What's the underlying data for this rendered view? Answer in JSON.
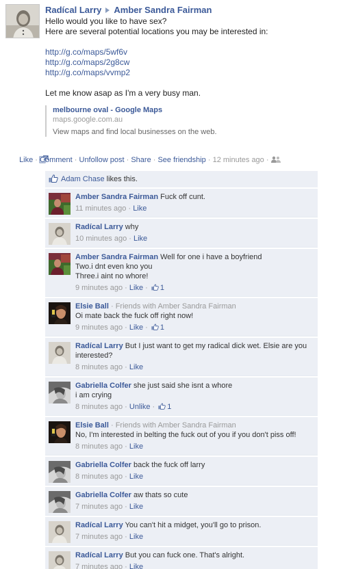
{
  "post": {
    "author": "Radícal Larry",
    "recipient": "Amber Sandra Fairman",
    "lines": [
      "Hello would you like to have sex?",
      "Here are several potential locations you may be interested in:"
    ],
    "links": [
      "http://g.co/maps/5wf6v",
      "http://g.co/maps/2g8cw",
      "http://g.co/maps/vvmp2"
    ],
    "closing": "Let me know asap as I'm a very busy man.",
    "attachment": {
      "title": "melbourne oval - Google Maps",
      "domain": "maps.google.com.au",
      "description": "View maps and find local businesses on the web."
    },
    "actions": {
      "like": "Like",
      "comment": "Comment",
      "unfollow": "Unfollow post",
      "share": "Share",
      "see_friendship": "See friendship",
      "time": "12 minutes ago",
      "dot": " · "
    }
  },
  "likes": {
    "who": "Adam Chase",
    "suffix": " likes this."
  },
  "comments": [
    {
      "author": "Amber Sandra Fairman",
      "text": "Fuck off cunt.",
      "time": "11 minutes ago",
      "action": "Like",
      "likes": "",
      "avatar": "amber"
    },
    {
      "author": "Radícal Larry",
      "text": "why",
      "time": "10 minutes ago",
      "action": "Like",
      "likes": "",
      "avatar": "larry"
    },
    {
      "author": "Amber Sandra Fairman",
      "text": "Well for one i have a boyfriend\nTwo.i dnt even kno you\nThree.i aint no whore!",
      "time": "9 minutes ago",
      "action": "Like",
      "likes": "1",
      "avatar": "amber"
    },
    {
      "author": "Elsie Ball",
      "meta": "Friends with Amber Sandra Fairman",
      "text": "Oi mate back the fuck off right now!",
      "time": "9 minutes ago",
      "action": "Like",
      "likes": "1",
      "avatar": "elsie"
    },
    {
      "author": "Radícal Larry",
      "text": "But I just want to get my radical dick wet. Elsie are you interested?",
      "time": "8 minutes ago",
      "action": "Like",
      "likes": "",
      "avatar": "larry"
    },
    {
      "author": "Gabriella Colfer",
      "text": "she just said she isnt a whore\ni am crying",
      "time": "8 minutes ago",
      "action": "Unlike",
      "likes": "1",
      "avatar": "gabriella"
    },
    {
      "author": "Elsie Ball",
      "meta": "Friends with Amber Sandra Fairman",
      "text": "No, I'm interested in belting the fuck out of you if you don't piss off!",
      "time": "8 minutes ago",
      "action": "Like",
      "likes": "",
      "avatar": "elsie"
    },
    {
      "author": "Gabriella Colfer",
      "text": "back the fuck off larry",
      "time": "8 minutes ago",
      "action": "Like",
      "likes": "",
      "avatar": "gabriella"
    },
    {
      "author": "Gabriella Colfer",
      "text": "aw thats so cute",
      "time": "7 minutes ago",
      "action": "Like",
      "likes": "",
      "avatar": "gabriella"
    },
    {
      "author": "Radícal Larry",
      "text": "You can't hit a midget, you'll go to prison.",
      "time": "7 minutes ago",
      "action": "Like",
      "likes": "",
      "avatar": "larry"
    },
    {
      "author": "Radícal Larry",
      "text": "But you can fuck one. That's alright.",
      "time": "7 minutes ago",
      "action": "Like",
      "likes": "",
      "avatar": "larry"
    }
  ],
  "colors": {
    "link": "#3b5998",
    "comment_bg": "#eceff5",
    "meta": "#999999"
  }
}
